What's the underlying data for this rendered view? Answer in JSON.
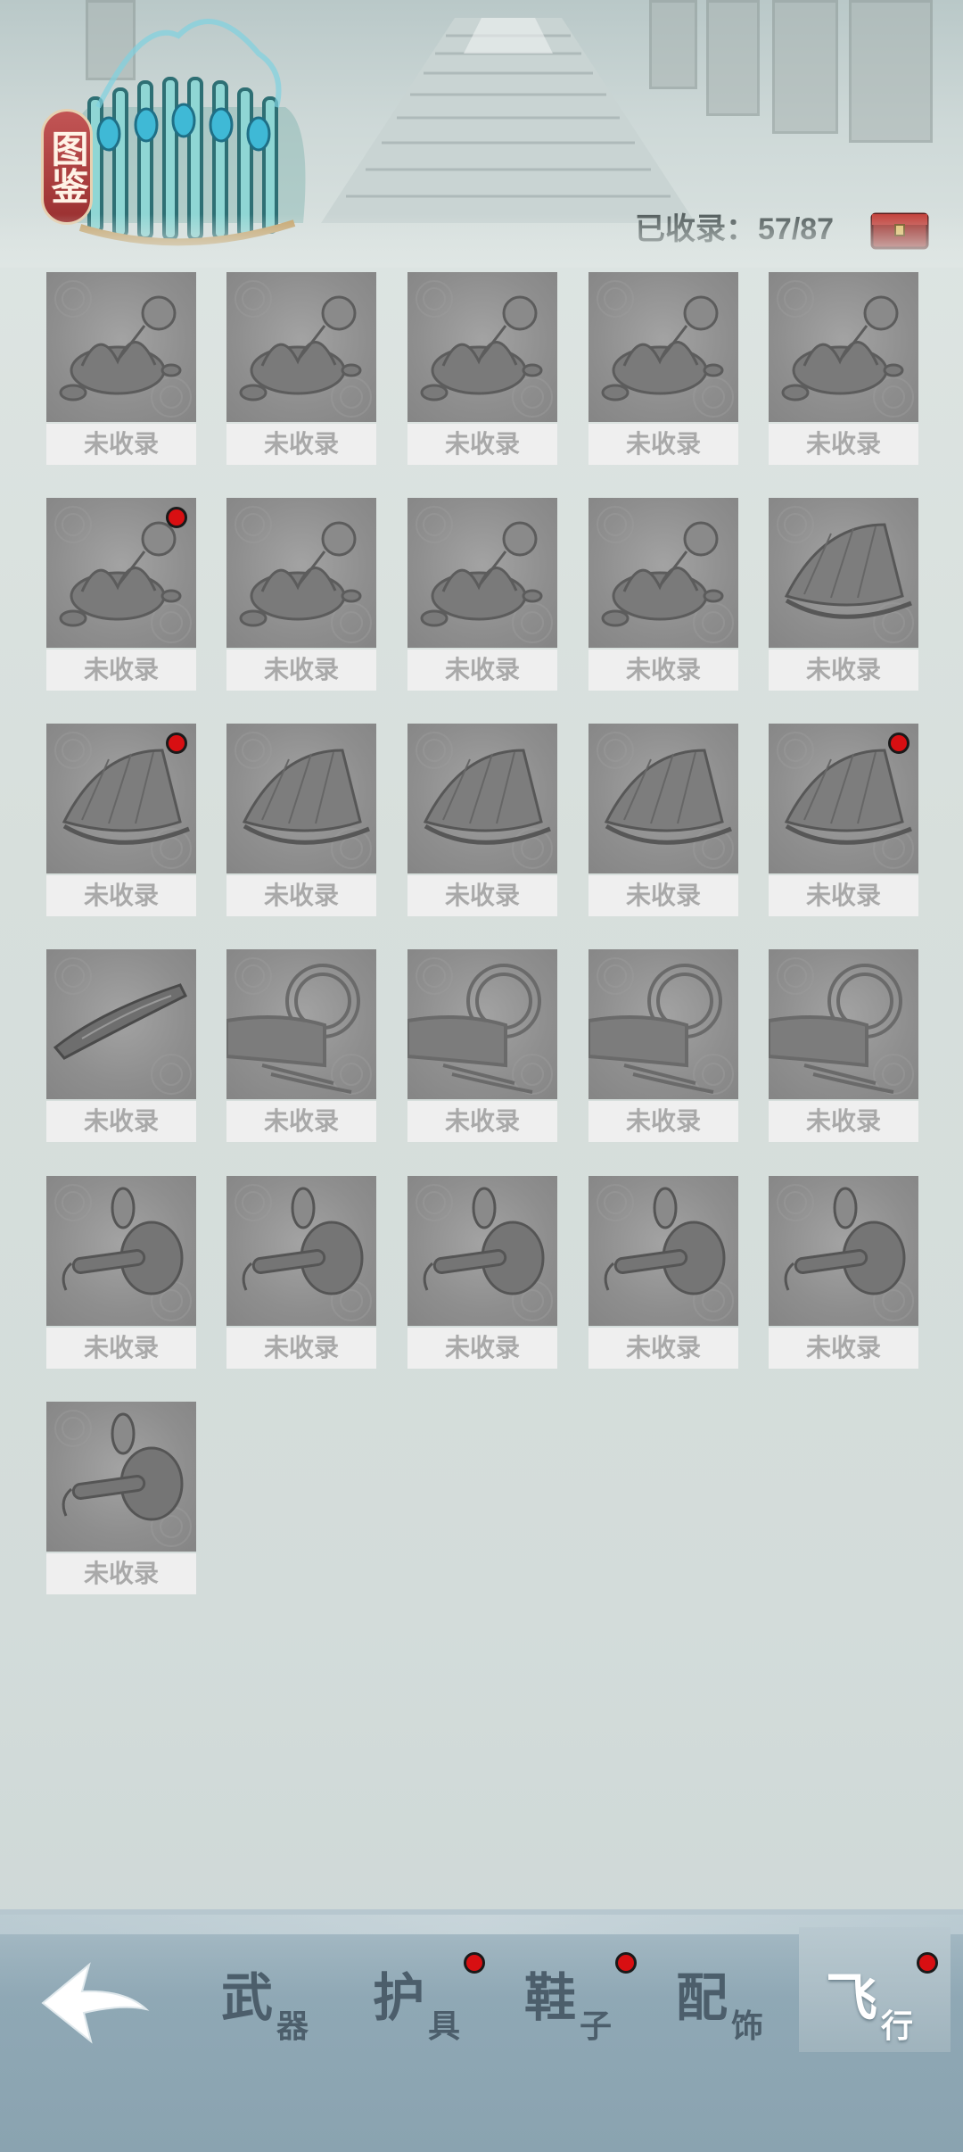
{
  "header": {
    "codex_label": "图鉴",
    "collected_label": "已收录：",
    "collected_value": "57/87"
  },
  "grid": {
    "items": [
      {
        "label": "未收录",
        "art": "lotus",
        "new": false
      },
      {
        "label": "未收录",
        "art": "lotus",
        "new": false
      },
      {
        "label": "未收录",
        "art": "lotus",
        "new": false
      },
      {
        "label": "未收录",
        "art": "lotus",
        "new": false
      },
      {
        "label": "未收录",
        "art": "lotus",
        "new": false
      },
      {
        "label": "未收录",
        "art": "lotus",
        "new": true
      },
      {
        "label": "未收录",
        "art": "lotus",
        "new": false
      },
      {
        "label": "未收录",
        "art": "lotus",
        "new": false
      },
      {
        "label": "未收录",
        "art": "lotus",
        "new": false
      },
      {
        "label": "未收录",
        "art": "fan",
        "new": false
      },
      {
        "label": "未收录",
        "art": "fan",
        "new": true
      },
      {
        "label": "未收录",
        "art": "fan",
        "new": false
      },
      {
        "label": "未收录",
        "art": "fan",
        "new": false
      },
      {
        "label": "未收录",
        "art": "fan",
        "new": false
      },
      {
        "label": "未收录",
        "art": "fan",
        "new": true
      },
      {
        "label": "未收录",
        "art": "blade",
        "new": false
      },
      {
        "label": "未收录",
        "art": "orb",
        "new": false
      },
      {
        "label": "未收录",
        "art": "orb",
        "new": false
      },
      {
        "label": "未收录",
        "art": "orb",
        "new": false
      },
      {
        "label": "未收录",
        "art": "orb",
        "new": false
      },
      {
        "label": "未收录",
        "art": "gourd",
        "new": false
      },
      {
        "label": "未收录",
        "art": "gourd",
        "new": false
      },
      {
        "label": "未收录",
        "art": "gourd",
        "new": false
      },
      {
        "label": "未收录",
        "art": "gourd",
        "new": false
      },
      {
        "label": "未收录",
        "art": "gourd",
        "new": false
      },
      {
        "label": "未收录",
        "art": "gourd",
        "new": false
      }
    ]
  },
  "bottom_nav": {
    "tabs": [
      {
        "id": "weapon",
        "big": "武",
        "small": "器",
        "dot": false,
        "active": false
      },
      {
        "id": "armor",
        "big": "护",
        "small": "具",
        "dot": true,
        "active": false
      },
      {
        "id": "shoes",
        "big": "鞋",
        "small": "子",
        "dot": true,
        "active": false
      },
      {
        "id": "accessory",
        "big": "配",
        "small": "饰",
        "dot": false,
        "active": false
      },
      {
        "id": "flying",
        "big": "飞",
        "small": "行",
        "dot": true,
        "active": true
      }
    ]
  },
  "colors": {
    "red_dot": "#d80f12",
    "label_bg": "#efefef",
    "label_text": "#a9a9a9"
  }
}
